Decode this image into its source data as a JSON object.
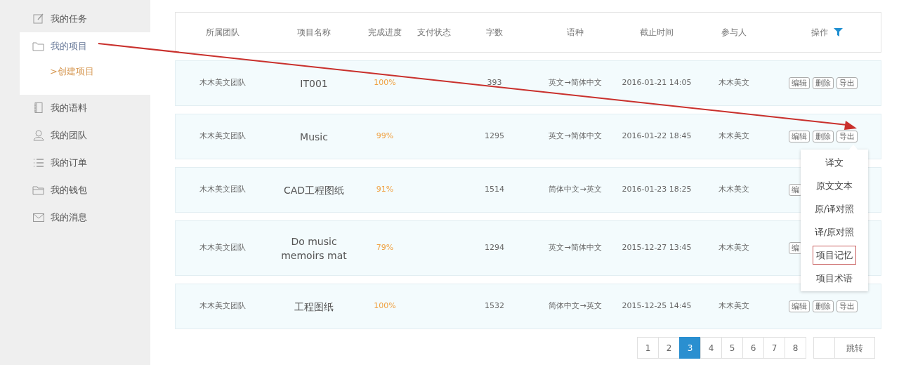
{
  "sidebar": {
    "items": [
      {
        "label": "我的任务",
        "selected": false
      },
      {
        "label": "我的项目",
        "selected": true,
        "children": [
          {
            "label": ">创建项目"
          }
        ]
      },
      {
        "label": "我的语料",
        "selected": false
      },
      {
        "label": "我的团队",
        "selected": false
      },
      {
        "label": "我的订单",
        "selected": false
      },
      {
        "label": "我的钱包",
        "selected": false
      },
      {
        "label": "我的消息",
        "selected": false
      }
    ]
  },
  "table": {
    "columns": [
      "所属团队",
      "项目名称",
      "完成进度",
      "支付状态",
      "字数",
      "语种",
      "截止时间",
      "参与人",
      "操作"
    ],
    "rows": [
      {
        "team": "木木美文团队",
        "name": "IT001",
        "progress": "100%",
        "words": "393",
        "language": "英文→简体中文",
        "deadline": "2016-01-21 14:05",
        "members": "木木美文",
        "actions": [
          "编辑",
          "删除",
          "导出"
        ]
      },
      {
        "team": "木木美文团队",
        "name": "Music",
        "progress": "99%",
        "words": "1295",
        "language": "英文→简体中文",
        "deadline": "2016-01-22 18:45",
        "members": "木木美文",
        "actions": [
          "编辑",
          "删除",
          "导出"
        ]
      },
      {
        "team": "木木美文团队",
        "name": "CAD工程图纸",
        "progress": "91%",
        "words": "1514",
        "language": "简体中文→英文",
        "deadline": "2016-01-23 18:25",
        "members": "木木美文",
        "actions": [
          "编"
        ]
      },
      {
        "team": "木木美文团队",
        "name": "Do music memoirs mat",
        "progress": "79%",
        "words": "1294",
        "language": "英文→简体中文",
        "deadline": "2015-12-27 13:45",
        "members": "木木美文",
        "actions": [
          "编"
        ]
      },
      {
        "team": "木木美文团队",
        "name": "工程图纸",
        "progress": "100%",
        "words": "1532",
        "language": "简体中文→英文",
        "deadline": "2015-12-25 14:45",
        "members": "木木美文",
        "actions": [
          "编辑",
          "删除",
          "导出"
        ]
      }
    ]
  },
  "export_menu": {
    "items": [
      {
        "label": "译文",
        "highlighted": false
      },
      {
        "label": "原文文本",
        "highlighted": false
      },
      {
        "label": "原/译对照",
        "highlighted": false
      },
      {
        "label": "译/原对照",
        "highlighted": false
      },
      {
        "label": "项目记忆",
        "highlighted": true
      },
      {
        "label": "项目术语",
        "highlighted": false
      }
    ]
  },
  "pagination": {
    "pages": [
      {
        "label": "1",
        "selected": false
      },
      {
        "label": "2",
        "selected": false
      },
      {
        "label": "3",
        "selected": true
      },
      {
        "label": "4",
        "selected": false
      },
      {
        "label": "5",
        "selected": false
      },
      {
        "label": "6",
        "selected": false
      },
      {
        "label": "7",
        "selected": false
      },
      {
        "label": "8",
        "selected": false
      }
    ],
    "jump_button": "跳转"
  }
}
